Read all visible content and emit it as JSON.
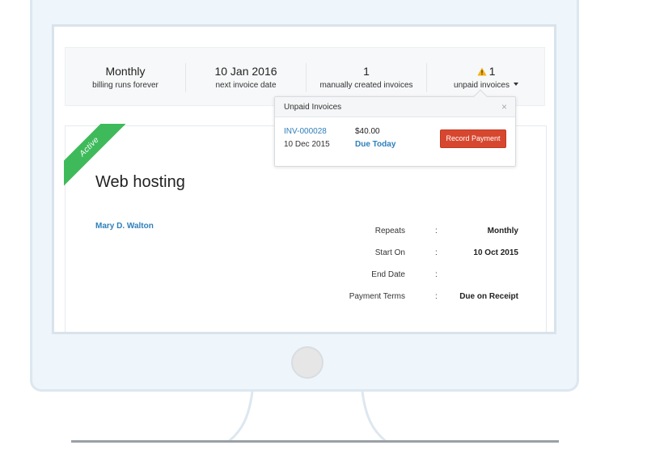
{
  "summary": {
    "billing": {
      "value": "Monthly",
      "label": "billing runs forever"
    },
    "next_invoice": {
      "value": "10 Jan 2016",
      "label": "next invoice date"
    },
    "manual": {
      "value": "1",
      "label": "manually created invoices"
    },
    "unpaid": {
      "value": "1",
      "label": "unpaid invoices",
      "icon": "warning-icon"
    }
  },
  "popover": {
    "title": "Unpaid Invoices",
    "close": "×",
    "invoice": {
      "number": "INV-000028",
      "date": "10 Dec 2015",
      "amount": "$40.00",
      "due": "Due Today"
    },
    "record_button": "Record Payment"
  },
  "card": {
    "status": "Active",
    "title": "Web hosting",
    "customer": "Mary D. Walton",
    "details": [
      {
        "label": "Repeats",
        "colon": ":",
        "value": "Monthly"
      },
      {
        "label": "Start On",
        "colon": ":",
        "value": "10 Oct 2015"
      },
      {
        "label": "End Date",
        "colon": ":",
        "value": ""
      },
      {
        "label": "Payment Terms",
        "colon": ":",
        "value": "Due on Receipt"
      }
    ]
  },
  "colors": {
    "accent_link": "#2f7fba",
    "active_ribbon": "#3fba5b",
    "record_button": "#d7472f",
    "warning": "#f3b21b"
  }
}
